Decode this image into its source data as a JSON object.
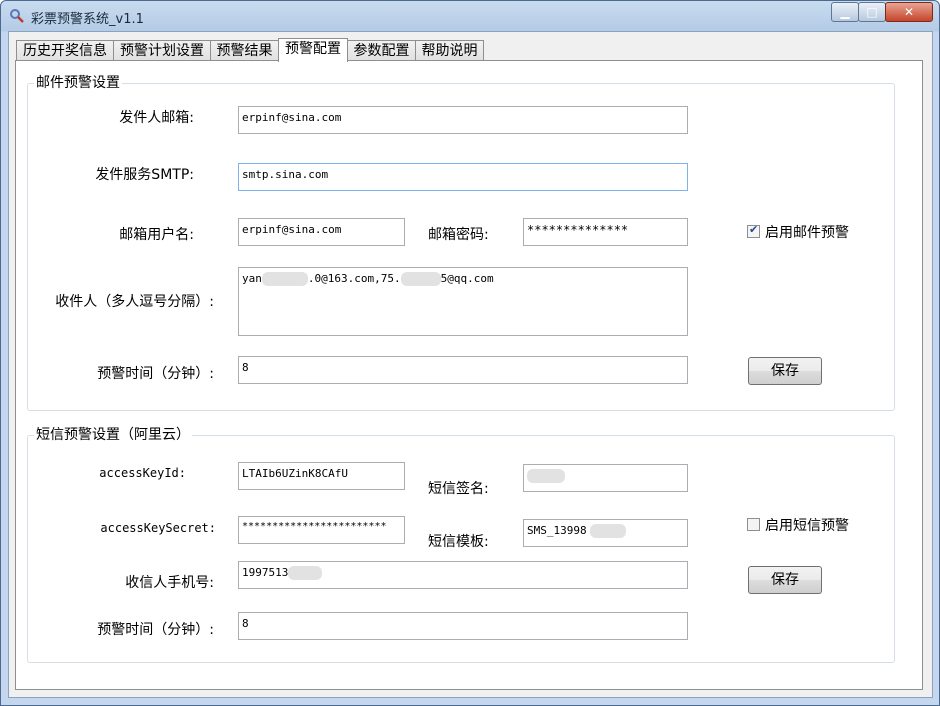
{
  "window": {
    "title": "彩票预警系统_v1.1"
  },
  "tabs": [
    {
      "label": "历史开奖信息"
    },
    {
      "label": "预警计划设置"
    },
    {
      "label": "预警结果"
    },
    {
      "label": "预警配置"
    },
    {
      "label": "参数配置"
    },
    {
      "label": "帮助说明"
    }
  ],
  "email": {
    "group_title": "邮件预警设置",
    "sender_label": "发件人邮箱:",
    "sender_value": "erpinf@sina.com",
    "smtp_label": "发件服务SMTP:",
    "smtp_value": "smtp.sina.com",
    "username_label": "邮箱用户名:",
    "username_value": "erpinf@sina.com",
    "password_label": "邮箱密码:",
    "password_value": "**************",
    "enable_label": "启用邮件预警",
    "enable_checked": true,
    "recipients_label": "收件人（多人逗号分隔）:",
    "recipients_part1": "yan",
    "recipients_part2": ".0@163.com,75.",
    "recipients_part3": "5@qq.com",
    "time_label": "预警时间（分钟）:",
    "time_value": "8",
    "save_label": "保存"
  },
  "sms": {
    "group_title": "短信预警设置（阿里云）",
    "key_id_label": "accessKeyId:",
    "key_id_value": "LTAIb6UZinK8CAfU",
    "key_secret_label": "accessKeySecret:",
    "key_secret_value": "************************",
    "sign_label": "短信签名:",
    "template_label": "短信模板:",
    "template_value": "SMS_13998",
    "enable_label": "启用短信预警",
    "enable_checked": false,
    "phone_label": "收信人手机号:",
    "phone_value": "1997513",
    "time_label": "预警时间（分钟）:",
    "time_value": "8",
    "save_label": "保存"
  }
}
